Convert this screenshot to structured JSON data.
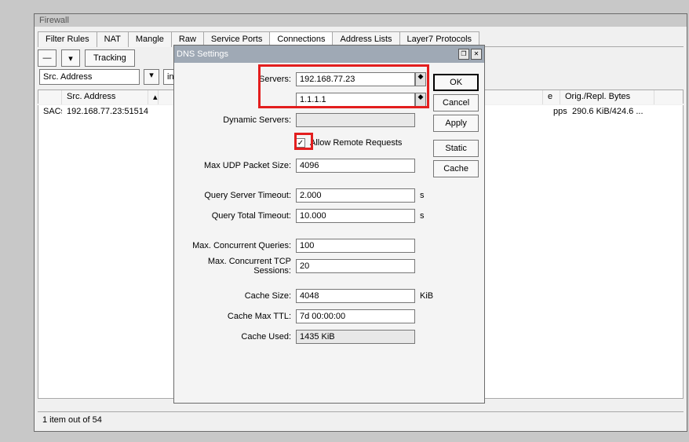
{
  "firewall": {
    "title": "Firewall",
    "tabs": [
      "Filter Rules",
      "NAT",
      "Mangle",
      "Raw",
      "Service Ports",
      "Connections",
      "Address Lists",
      "Layer7 Protocols"
    ],
    "active_tab_index": 5,
    "tracking_btn": "Tracking",
    "filter": {
      "field": "Src. Address",
      "op": "in"
    },
    "columns": [
      "",
      "Src. Address",
      "",
      "",
      "",
      "Orig./Repl. Bytes"
    ],
    "row": {
      "proto": "SACs",
      "src": "192.168.77.23:51514",
      "tag": "pps",
      "bytes": "290.6 KiB/424.6 ..."
    },
    "status": "1 item out of 54"
  },
  "dns": {
    "title": "DNS Settings",
    "servers": {
      "label": "Servers:",
      "v1": "192.168.77.23",
      "v2": "1.1.1.1"
    },
    "dynamic": {
      "label": "Dynamic Servers:",
      "value": ""
    },
    "allow_remote": "Allow Remote Requests",
    "max_udp": {
      "label": "Max UDP Packet Size:",
      "value": "4096"
    },
    "q_server_to": {
      "label": "Query Server Timeout:",
      "value": "2.000",
      "unit": "s"
    },
    "q_total_to": {
      "label": "Query Total Timeout:",
      "value": "10.000",
      "unit": "s"
    },
    "max_conc_q": {
      "label": "Max. Concurrent Queries:",
      "value": "100"
    },
    "max_conc_tcp": {
      "label": "Max. Concurrent TCP Sessions:",
      "value": "20"
    },
    "cache_size": {
      "label": "Cache Size:",
      "value": "4048",
      "unit": "KiB"
    },
    "cache_ttl": {
      "label": "Cache Max TTL:",
      "value": "7d 00:00:00"
    },
    "cache_used": {
      "label": "Cache Used:",
      "value": "1435 KiB"
    },
    "buttons": {
      "ok": "OK",
      "cancel": "Cancel",
      "apply": "Apply",
      "static": "Static",
      "cache": "Cache"
    }
  }
}
